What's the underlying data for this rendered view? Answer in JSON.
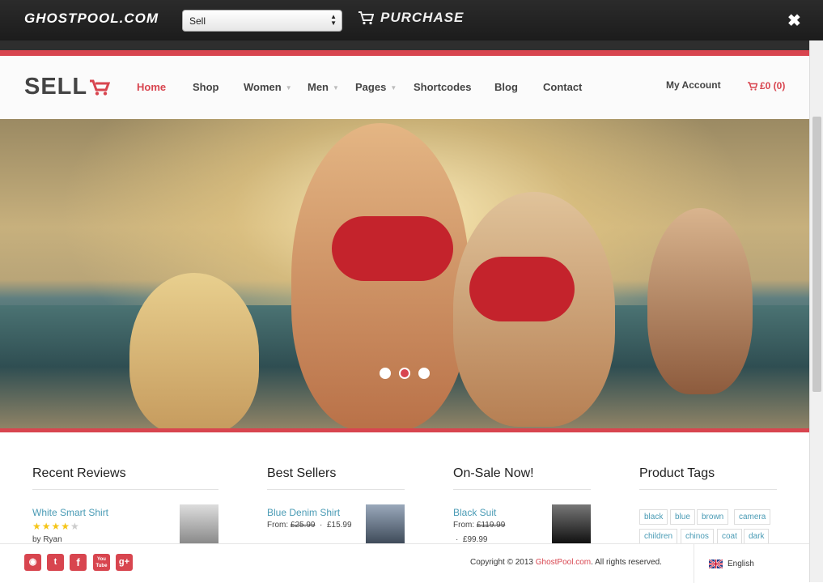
{
  "topbar": {
    "brand": "GHOSTPOOL.COM",
    "theme_select_value": "Sell",
    "purchase_label": "PURCHASE",
    "close_label": "✖"
  },
  "header": {
    "logo": "SELL",
    "nav": [
      {
        "label": "Home",
        "active": true
      },
      {
        "label": "Shop"
      },
      {
        "label": "Women"
      },
      {
        "label": "Men"
      },
      {
        "label": "Pages"
      },
      {
        "label": "Shortcodes"
      },
      {
        "label": "Blog"
      },
      {
        "label": "Contact"
      }
    ],
    "account_label": "My Account",
    "cart_label": "£0 (0)"
  },
  "slider": {
    "dots": 3,
    "active_dot": 2
  },
  "widgets": {
    "recent_reviews": {
      "title": "Recent Reviews",
      "item_name": "White Smart Shirt",
      "rating": 4,
      "rating_max": 5,
      "by": "by Ryan"
    },
    "best_sellers": {
      "title": "Best Sellers",
      "item_name": "Blue Denim Shirt",
      "price_from_label": "From:",
      "old_price": "£25.99",
      "separator": "·",
      "new_price": "£15.99"
    },
    "on_sale": {
      "title": "On-Sale Now!",
      "item_name": "Black Suit",
      "price_from_label": "From:",
      "old_price": "£119.99",
      "separator": "·",
      "new_price": "£99.99"
    },
    "product_tags": {
      "title": "Product Tags",
      "tags": [
        "black",
        "blue",
        "brown",
        "camera",
        "children",
        "chinos",
        "coat",
        "dark"
      ]
    }
  },
  "footer": {
    "social": [
      "rss-icon",
      "twitter-icon",
      "facebook-icon",
      "youtube-icon",
      "google-plus-icon"
    ],
    "social_glyphs": [
      "◉",
      "t",
      "f",
      "You\nTube",
      "g+"
    ],
    "copyright_prefix": "Copyright © 2013 ",
    "copyright_site": "GhostPool.com",
    "copyright_suffix": ". All rights reserved.",
    "language": "English"
  },
  "colors": {
    "accent": "#d8454f",
    "link": "#4a9bb5",
    "star": "#f5c518",
    "topbar": "#222222"
  }
}
